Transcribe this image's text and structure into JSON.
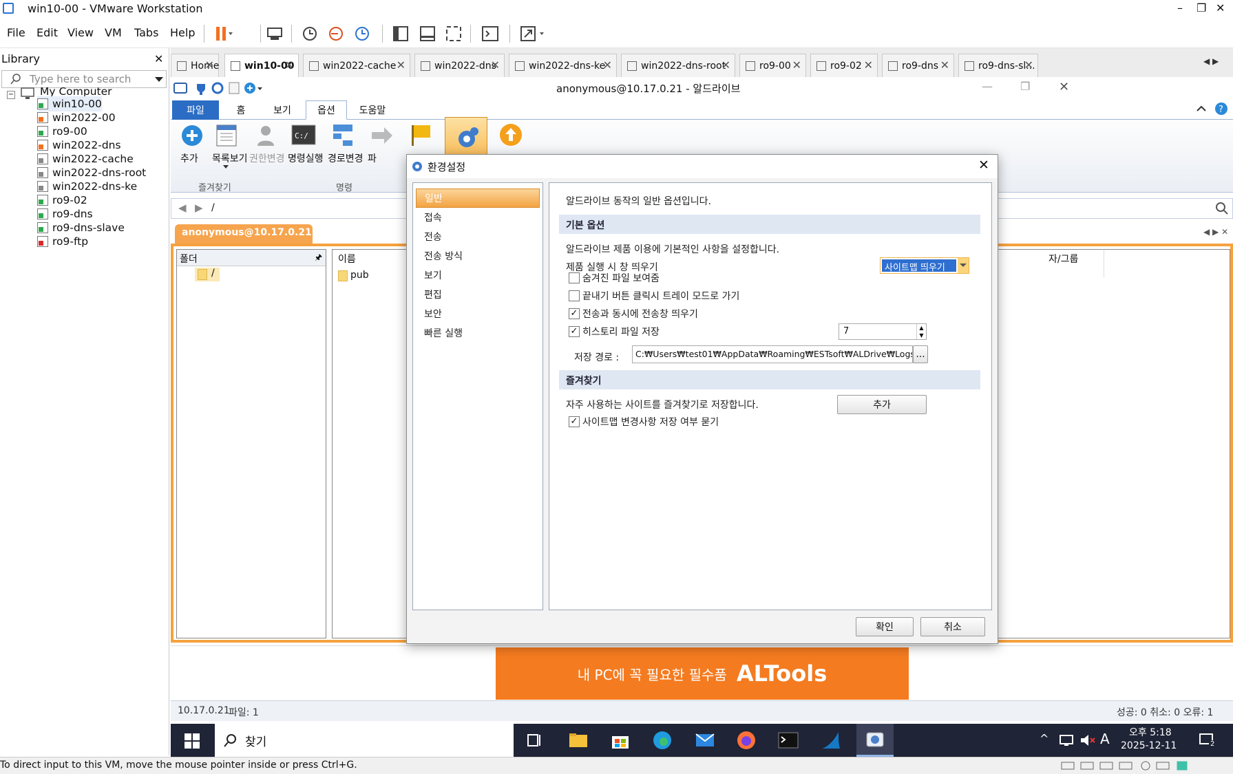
{
  "vmware": {
    "title": "win10-00 - VMware Workstation",
    "minimize": "–",
    "maximize": "❐",
    "close": "✕",
    "menu": [
      "File",
      "Edit",
      "View",
      "VM",
      "Tabs",
      "Help"
    ]
  },
  "library": {
    "title": "Library",
    "close": "✕",
    "search_placeholder": "Type here to search",
    "root": "My Computer",
    "items": [
      {
        "label": "win10-00",
        "state": "running"
      },
      {
        "label": "win2022-00",
        "state": "paused"
      },
      {
        "label": "ro9-00",
        "state": "running"
      },
      {
        "label": "win2022-dns",
        "state": "paused"
      },
      {
        "label": "win2022-cache",
        "state": "off"
      },
      {
        "label": "win2022-dns-root",
        "state": "off"
      },
      {
        "label": "win2022-dns-ke",
        "state": "off"
      },
      {
        "label": "ro9-02",
        "state": "running"
      },
      {
        "label": "ro9-dns",
        "state": "running"
      },
      {
        "label": "ro9-dns-slave",
        "state": "running"
      },
      {
        "label": "ro9-ftp",
        "state": "error"
      }
    ]
  },
  "vm_tabs": [
    {
      "label": "Home",
      "active": false
    },
    {
      "label": "win10-00",
      "active": true
    },
    {
      "label": "win2022-cache",
      "active": false
    },
    {
      "label": "win2022-dns",
      "active": false
    },
    {
      "label": "win2022-dns-ke",
      "active": false
    },
    {
      "label": "win2022-dns-root",
      "active": false
    },
    {
      "label": "ro9-00",
      "active": false
    },
    {
      "label": "ro9-02",
      "active": false
    },
    {
      "label": "ro9-dns",
      "active": false
    },
    {
      "label": "ro9-dns-sl...",
      "active": false
    }
  ],
  "aldrive": {
    "window_title": "anonymous@10.17.0.21 - 알드라이브",
    "ribbon_tabs": [
      "파일",
      "홈",
      "보기",
      "옵션",
      "도움말"
    ],
    "ribbon_buttons": {
      "add": "추가",
      "list": "목록보기",
      "perm": "권한변경",
      "cmd": "명령실행",
      "path": "경로변경",
      "file_cut": "파"
    },
    "groups": {
      "favorites": "즐겨찾기",
      "command": "명령"
    },
    "address": "/",
    "session_tab": "anonymous@10.17.0.21",
    "folder_header": "폴더",
    "root_folder": "/",
    "name_header": "이름",
    "file_item": "pub",
    "right_col_header": "자/그룹",
    "banner_text": "내 PC에 꼭 필요한 필수품",
    "banner_brand": "ALTools",
    "status_ip": "10.17.0.21",
    "status_files": "파일: 1",
    "status_right": "성공: 0  취소: 0  오류: 1"
  },
  "dialog": {
    "title": "환경설정",
    "nav": [
      "일반",
      "접속",
      "전송",
      "전송 방식",
      "보기",
      "편집",
      "보안",
      "빠른 실행"
    ],
    "selected_nav": "일반",
    "intro": "알드라이브 동작의 일반 옵션입니다.",
    "section_basic": "기본 옵션",
    "basic_desc": "알드라이브 제품 이용에 기본적인 사항을 설정합니다.",
    "startup_label": "제품 실행 시 창 띄우기",
    "startup_value": "사이트맵 띄우기",
    "options": [
      {
        "label": "숨겨진 파일 보여줌",
        "checked": false
      },
      {
        "label": "끝내기 버튼 클릭시 트레이 모드로 가기",
        "checked": false
      },
      {
        "label": "전송과 동시에 전송창 띄우기",
        "checked": true
      },
      {
        "label": "히스토리 파일 저장",
        "checked": true
      }
    ],
    "history_count": "7",
    "save_path_label": "저장 경로 :",
    "save_path": "C:₩Users₩test01₩AppData₩Roaming₩ESTsoft₩ALDrive₩Logs",
    "browse": "...",
    "section_fav": "즐겨찾기",
    "fav_desc": "자주 사용하는 사이트를 즐겨찾기로 저장합니다.",
    "fav_add": "추가",
    "sitemap_confirm": {
      "label": "사이트맵 변경사항 저장 여부 묻기",
      "checked": true
    },
    "ok": "확인",
    "cancel": "취소"
  },
  "taskbar": {
    "search": "찾기",
    "time": "오후 5:18",
    "date": "2025-12-11",
    "ime": "A",
    "notif_count": "2"
  },
  "vm_status_text": "To direct input to this VM, move the mouse pointer inside or press Ctrl+G.",
  "colors": {
    "accent_orange": "#f47b20",
    "ribbon_blue": "#2b6cc4",
    "taskbar": "#1f2436"
  }
}
